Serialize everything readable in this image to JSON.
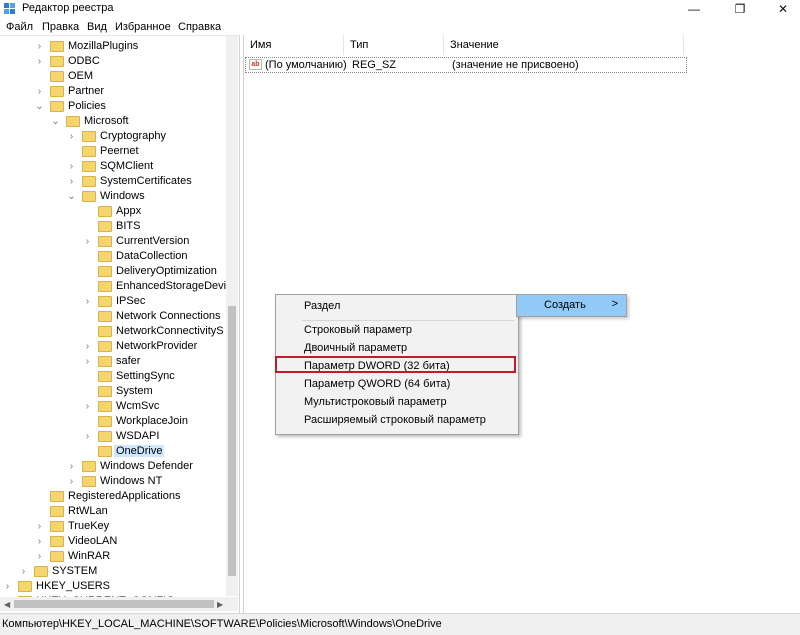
{
  "window": {
    "title": "Редактор реестра",
    "minimize": "—",
    "maximize": "❐",
    "close": "✕"
  },
  "menu": [
    "Файл",
    "Правка",
    "Вид",
    "Избранное",
    "Справка"
  ],
  "tree": [
    {
      "label": "MozillaPlugins",
      "level": 3,
      "expander": ">"
    },
    {
      "label": "ODBC",
      "level": 3,
      "expander": ">"
    },
    {
      "label": "OEM",
      "level": 3,
      "expander": ""
    },
    {
      "label": "Partner",
      "level": 3,
      "expander": ">"
    },
    {
      "label": "Policies",
      "level": 3,
      "expander": "v"
    },
    {
      "label": "Microsoft",
      "level": 4,
      "expander": "v"
    },
    {
      "label": "Cryptography",
      "level": 5,
      "expander": ">"
    },
    {
      "label": "Peernet",
      "level": 5,
      "expander": ""
    },
    {
      "label": "SQMClient",
      "level": 5,
      "expander": ">"
    },
    {
      "label": "SystemCertificates",
      "level": 5,
      "expander": ">"
    },
    {
      "label": "Windows",
      "level": 5,
      "expander": "v"
    },
    {
      "label": "Appx",
      "level": 6,
      "expander": ""
    },
    {
      "label": "BITS",
      "level": 6,
      "expander": ""
    },
    {
      "label": "CurrentVersion",
      "level": 6,
      "expander": ">"
    },
    {
      "label": "DataCollection",
      "level": 6,
      "expander": ""
    },
    {
      "label": "DeliveryOptimization",
      "level": 6,
      "expander": ""
    },
    {
      "label": "EnhancedStorageDevi",
      "level": 6,
      "expander": ""
    },
    {
      "label": "IPSec",
      "level": 6,
      "expander": ">"
    },
    {
      "label": "Network Connections",
      "level": 6,
      "expander": ""
    },
    {
      "label": "NetworkConnectivityS",
      "level": 6,
      "expander": ""
    },
    {
      "label": "NetworkProvider",
      "level": 6,
      "expander": ">"
    },
    {
      "label": "safer",
      "level": 6,
      "expander": ">"
    },
    {
      "label": "SettingSync",
      "level": 6,
      "expander": ""
    },
    {
      "label": "System",
      "level": 6,
      "expander": ""
    },
    {
      "label": "WcmSvc",
      "level": 6,
      "expander": ">"
    },
    {
      "label": "WorkplaceJoin",
      "level": 6,
      "expander": ""
    },
    {
      "label": "WSDAPI",
      "level": 6,
      "expander": ">"
    },
    {
      "label": "OneDrive",
      "level": 6,
      "expander": "",
      "selected": true
    },
    {
      "label": "Windows Defender",
      "level": 5,
      "expander": ">"
    },
    {
      "label": "Windows NT",
      "level": 5,
      "expander": ">"
    },
    {
      "label": "RegisteredApplications",
      "level": 3,
      "expander": ""
    },
    {
      "label": "RtWLan",
      "level": 3,
      "expander": ""
    },
    {
      "label": "TrueKey",
      "level": 3,
      "expander": ">"
    },
    {
      "label": "VideoLAN",
      "level": 3,
      "expander": ">"
    },
    {
      "label": "WinRAR",
      "level": 3,
      "expander": ">"
    },
    {
      "label": "SYSTEM",
      "level": 2,
      "expander": ">"
    },
    {
      "label": "HKEY_USERS",
      "level": 1,
      "expander": ">"
    },
    {
      "label": "HKEY_CURRENT_CONFIG",
      "level": 1,
      "expander": ">"
    }
  ],
  "list": {
    "columns": [
      "Имя",
      "Тип",
      "Значение"
    ],
    "rows": [
      {
        "icon": "ab",
        "name": "(По умолчанию)",
        "type": "REG_SZ",
        "value": "(значение не присвоено)"
      }
    ]
  },
  "context_menu": {
    "items": [
      "Раздел",
      "Строковый параметр",
      "Двоичный параметр",
      "Параметр DWORD (32 бита)",
      "Параметр QWORD (64 бита)",
      "Мультистроковый параметр",
      "Расширяемый строковый параметр"
    ],
    "highlighted_index": 3,
    "highlight_color": "#c41a2c"
  },
  "submenu": {
    "label": "Создать",
    "arrow": ">",
    "color": "#91c9f7"
  },
  "status": "Компьютер\\HKEY_LOCAL_MACHINE\\SOFTWARE\\Policies\\Microsoft\\Windows\\OneDrive"
}
